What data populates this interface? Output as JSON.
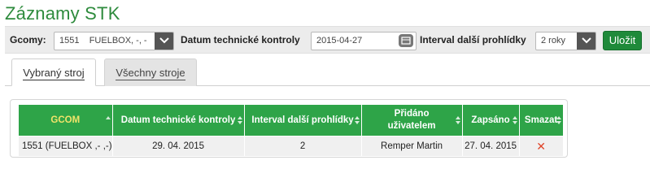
{
  "page": {
    "title": "Záznamy STK"
  },
  "filters": {
    "gcom_label": "Gcomy:",
    "gcom_value": "1551    FUELBOX, -, -",
    "date_label": "Datum technické kontroly",
    "date_value": "2015-04-27",
    "interval_label": "Interval další prohlídky",
    "interval_value": "2 roky",
    "save_label": "Uložit"
  },
  "tabs": [
    {
      "label": "Vybraný stroj",
      "active": true
    },
    {
      "label": "Všechny stroje",
      "active": false
    }
  ],
  "table": {
    "headers": {
      "gcom": "GCOM",
      "date": "Datum technické kontroly",
      "interval": "Interval další prohlídky",
      "added_by_line1": "Přidáno",
      "added_by_line2": "uživatelem",
      "written": "Zapsáno",
      "delete": "Smazat"
    },
    "rows": [
      {
        "gcom": "1551 (FUELBOX ,- ,-)",
        "date": "29. 04. 2015",
        "interval": "2",
        "added_by": "Remper Martin",
        "written": "27. 04. 2015",
        "delete_icon": "delete-x-icon"
      }
    ]
  },
  "colors": {
    "title": "#2e8b3d",
    "header_bg": "#2ea448",
    "gcom_header_text": "#f1e46a",
    "save_button": "#1f8a3a",
    "delete_icon": "#e0452a"
  }
}
